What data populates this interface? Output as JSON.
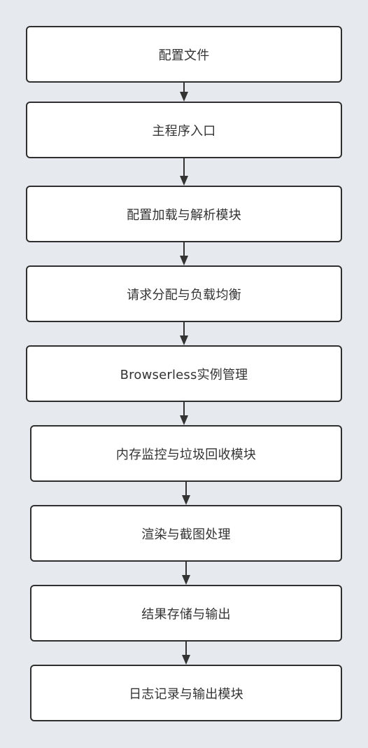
{
  "diagram": {
    "nodes": [
      {
        "id": "config-file",
        "label": "配置文件"
      },
      {
        "id": "main-entry",
        "label": "主程序入口"
      },
      {
        "id": "config-loader",
        "label": "配置加载与解析模块"
      },
      {
        "id": "request-dispatch",
        "label": "请求分配与负载均衡"
      },
      {
        "id": "browserless-instances",
        "label": "Browserless实例管理"
      },
      {
        "id": "memory-gc",
        "label": "内存监控与垃圾回收模块"
      },
      {
        "id": "render-screenshot",
        "label": "渲染与截图处理"
      },
      {
        "id": "result-storage",
        "label": "结果存储与输出"
      },
      {
        "id": "log-output",
        "label": "日志记录与输出模块"
      }
    ],
    "edges": [
      {
        "from": "config-file",
        "to": "main-entry"
      },
      {
        "from": "main-entry",
        "to": "config-loader"
      },
      {
        "from": "config-loader",
        "to": "request-dispatch"
      },
      {
        "from": "request-dispatch",
        "to": "browserless-instances"
      },
      {
        "from": "browserless-instances",
        "to": "memory-gc"
      },
      {
        "from": "memory-gc",
        "to": "render-screenshot"
      },
      {
        "from": "render-screenshot",
        "to": "result-storage"
      },
      {
        "from": "result-storage",
        "to": "log-output"
      }
    ],
    "colors": {
      "background": "#e6eaee",
      "node_fill": "#ffffff",
      "node_border": "#2f2f2f",
      "text": "#333333",
      "arrow": "#333333"
    }
  }
}
